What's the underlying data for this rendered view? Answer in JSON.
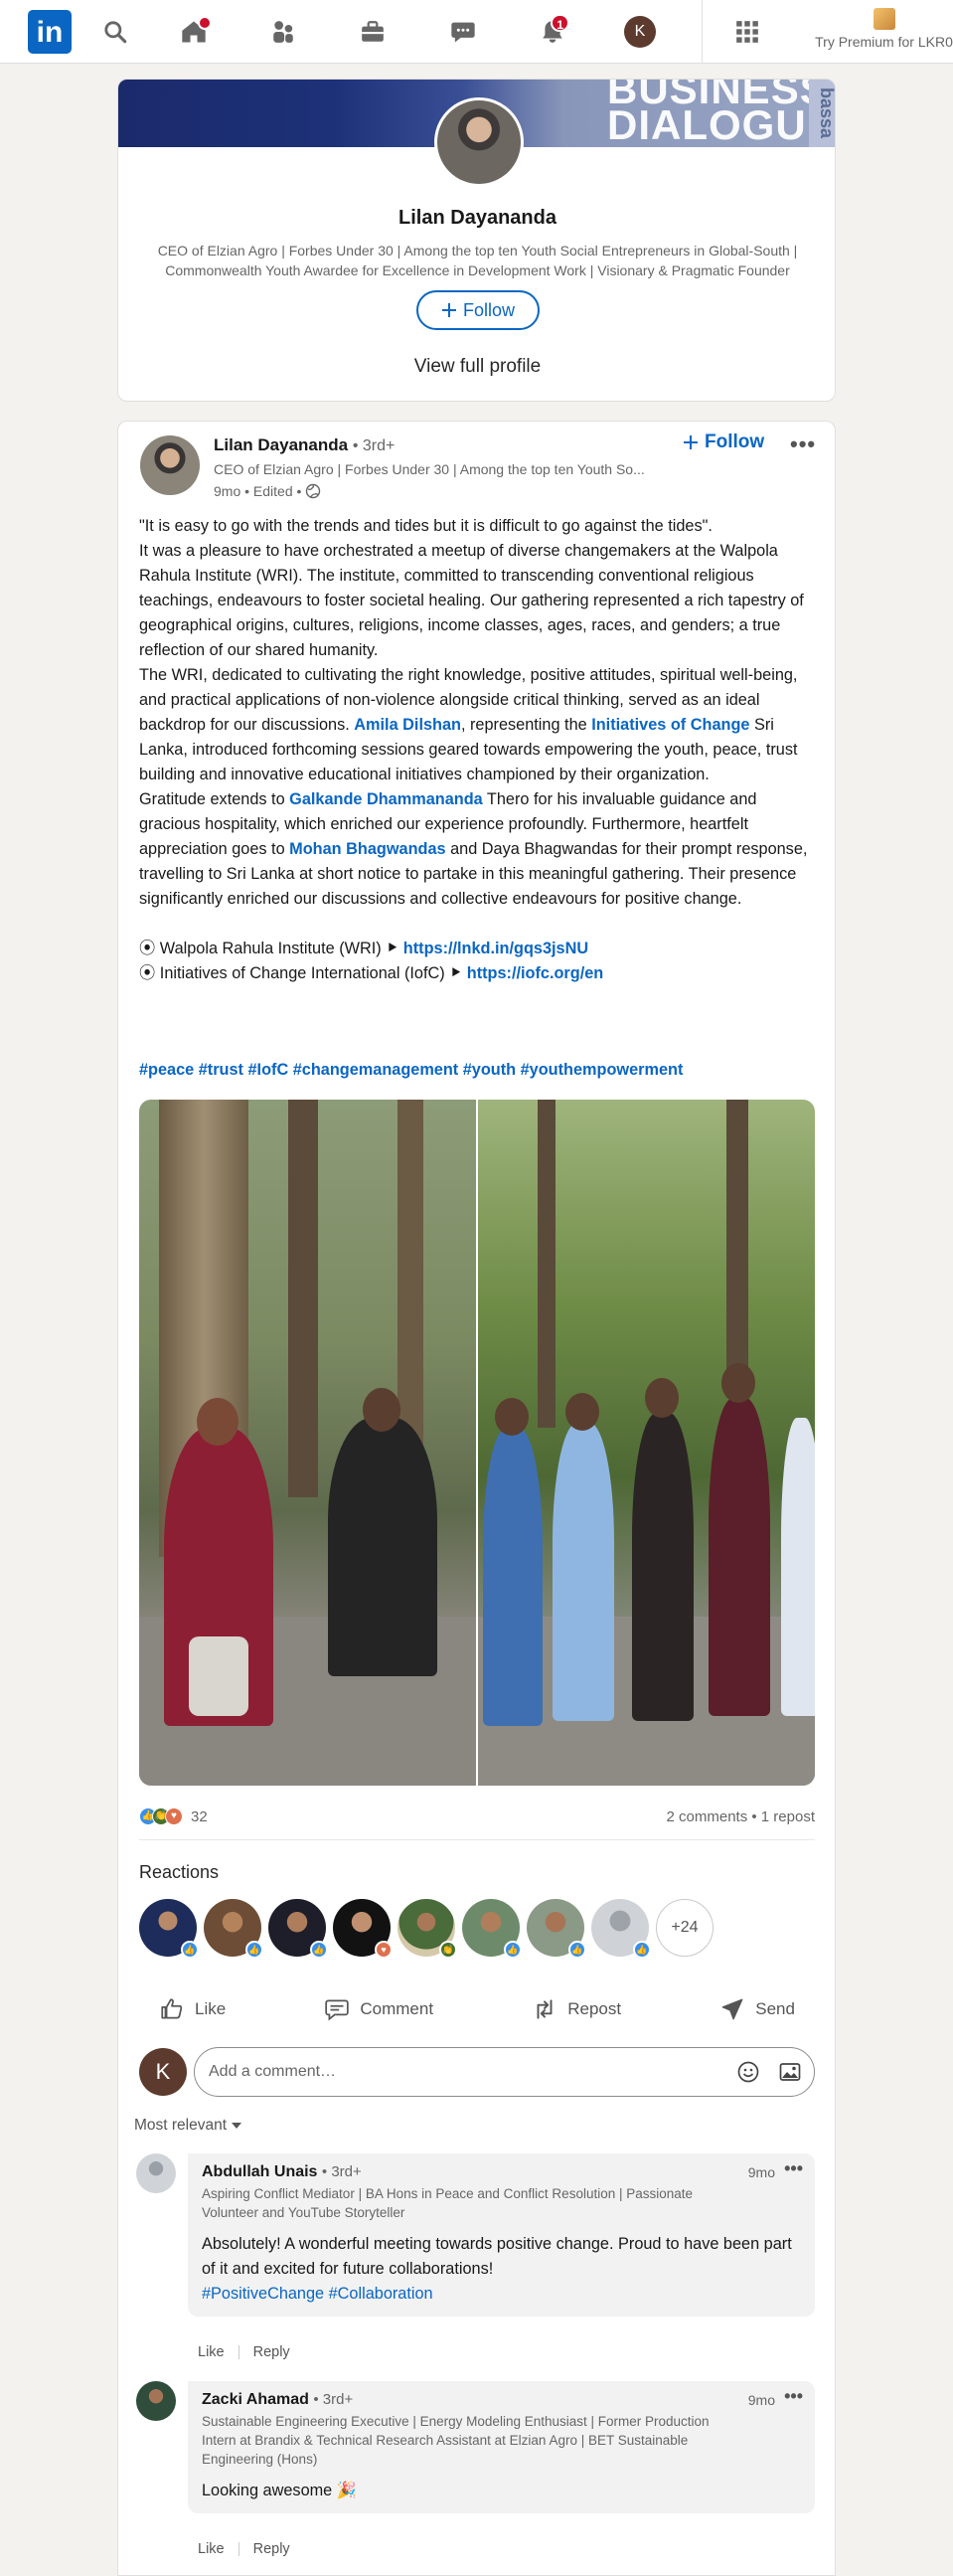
{
  "nav": {
    "logo": "in",
    "notifications_badge": "1",
    "messaging_badge": "",
    "avatar_initial": "K",
    "premium_label": "Try Premium for LKR0"
  },
  "profile_card": {
    "banner_text": "BUSINESS\nDIALOGUE",
    "banner_side_text": "bassa",
    "name": "Lilan Dayananda",
    "headline": "CEO of Elzian Agro | Forbes Under 30 | Among the top ten Youth Social Entrepreneurs in Global-South | Commonwealth Youth Awardee for Excellence in Development Work | Visionary & Pragmatic Founder",
    "follow_label": "Follow",
    "view_profile_label": "View full profile"
  },
  "post": {
    "author_name": "Lilan Dayananda",
    "author_degree": "• 3rd+",
    "author_headline": "CEO of Elzian Agro | Forbes Under 30 | Among the top ten Youth So...",
    "meta": "9mo • Edited •",
    "follow_label": "Follow",
    "more_label": "•••",
    "body": {
      "p1": "\"It is easy to go with the trends and tides but it is difficult to go against the tides\".",
      "p2": "It was a pleasure to have orchestrated a meetup of diverse changemakers at the Walpola Rahula Institute (WRI). The institute, committed to transcending conventional religious teachings, endeavours to foster societal healing. Our gathering represented a rich tapestry of geographical origins, cultures, religions, income classes, ages, races, and genders; a true reflection of our shared humanity.",
      "p3_a": "The WRI, dedicated to cultivating the right knowledge, positive attitudes, spiritual well-being, and practical applications of non-violence alongside critical thinking, served as an ideal backdrop for our discussions. ",
      "p3_mention1": "Amila Dilshan",
      "p3_b": ", representing the ",
      "p3_mention2": "Initiatives of Change",
      "p3_c": " Sri Lanka, introduced forthcoming sessions geared towards empowering the youth, peace, trust building and innovative educational initiatives championed by their organization.",
      "p4_a": "Gratitude extends to ",
      "p4_mention1": "Galkande Dhammananda",
      "p4_b": " Thero for his invaluable guidance and gracious hospitality, which enriched our experience profoundly. Furthermore, heartfelt appreciation goes to ",
      "p4_mention2": "Mohan Bhagwandas",
      "p4_c": " and Daya Bhagwandas for their prompt response, travelling to Sri Lanka at short notice to partake in this meaningful gathering. Their presence significantly enriched our discussions and collective endeavours for positive change.",
      "link1_label": "⦿ Walpola Rahula Institute (WRI) ⯈ ",
      "link1_url": "https://lnkd.in/gqs3jsNU",
      "link2_label": "⦿ Initiatives of Change International (IofC) ⯈ ",
      "link2_url": "https://iofc.org/en"
    },
    "hashtags": "#peace #trust #IofC #changemanagement #youth #youthempowerment",
    "reaction_count": "32",
    "comments_reposts": "2 comments • 1 repost",
    "reactions_title": "Reactions",
    "reactors_more": "+24",
    "actions": {
      "like": "Like",
      "comment": "Comment",
      "repost": "Repost",
      "send": "Send"
    },
    "comment_placeholder": "Add a comment…",
    "my_avatar_initial": "K",
    "sort_label": "Most relevant"
  },
  "comments": [
    {
      "name": "Abdullah Unais",
      "degree": "• 3rd+",
      "headline": "Aspiring Conflict Mediator | BA Hons in Peace and Conflict Resolution | Passionate Volunteer and YouTube Storyteller",
      "text": "Absolutely! A wonderful meeting towards positive change. Proud to have been part of it and excited for future collaborations!",
      "hashtags": "#PositiveChange #Collaboration",
      "time": "9mo",
      "like": "Like",
      "reply": "Reply"
    },
    {
      "name": "Zacki Ahamad",
      "degree": "• 3rd+",
      "headline": "Sustainable Engineering Executive | Energy Modeling Enthusiast | Former Production Intern at Brandix & Technical Research Assistant at Elzian Agro | BET Sustainable Engineering (Hons)",
      "text": "Looking awesome 🎉",
      "time": "9mo",
      "like": "Like",
      "reply": "Reply"
    }
  ],
  "colors": {
    "brand_blue": "#0a66c2",
    "page_bg": "#f4f2ee",
    "badge_red": "#cb112d"
  }
}
